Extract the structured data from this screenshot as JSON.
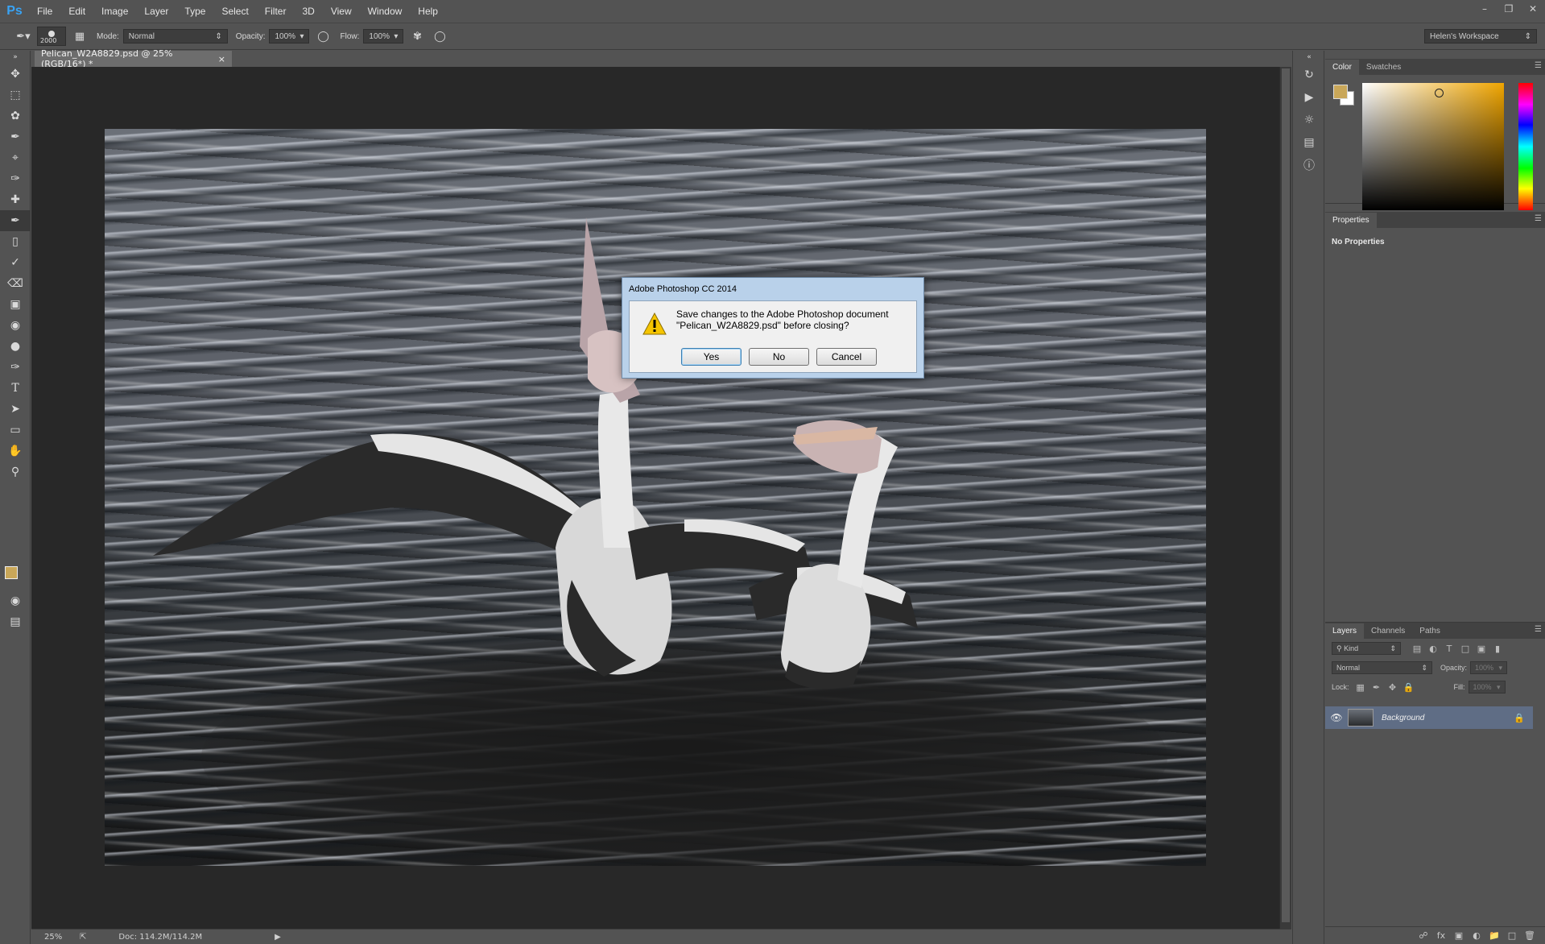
{
  "app": {
    "logo": "Ps",
    "menus": [
      "File",
      "Edit",
      "Image",
      "Layer",
      "Type",
      "Select",
      "Filter",
      "3D",
      "View",
      "Window",
      "Help"
    ]
  },
  "options": {
    "brush_size": "2000",
    "mode_label": "Mode:",
    "mode_value": "Normal",
    "opacity_label": "Opacity:",
    "opacity_value": "100%",
    "flow_label": "Flow:",
    "flow_value": "100%",
    "workspace": "Helen's Workspace"
  },
  "document": {
    "tab_title": "Pelican_W2A8829.psd @ 25% (RGB/16*) *",
    "close_glyph": "×"
  },
  "status": {
    "zoom": "25%",
    "doc_size": "Doc: 114.2M/114.2M"
  },
  "panels": {
    "color_tabs": [
      "Color",
      "Swatches"
    ],
    "foreground_color": "#c9a759",
    "background_color": "#ffffff",
    "properties_tab": "Properties",
    "no_properties": "No Properties",
    "layers_tabs": [
      "Layers",
      "Channels",
      "Paths"
    ],
    "kind_label": "Kind",
    "blend_mode": "Normal",
    "opacity_label": "Opacity:",
    "opacity_value": "100%",
    "lock_label": "Lock:",
    "fill_label": "Fill:",
    "fill_value": "100%",
    "layer_name": "Background"
  },
  "dialog": {
    "title": "Adobe Photoshop CC 2014",
    "message_line1": "Save changes to the Adobe Photoshop document",
    "message_line2": "\"Pelican_W2A8829.psd\" before closing?",
    "yes": "Yes",
    "no": "No",
    "cancel": "Cancel"
  }
}
